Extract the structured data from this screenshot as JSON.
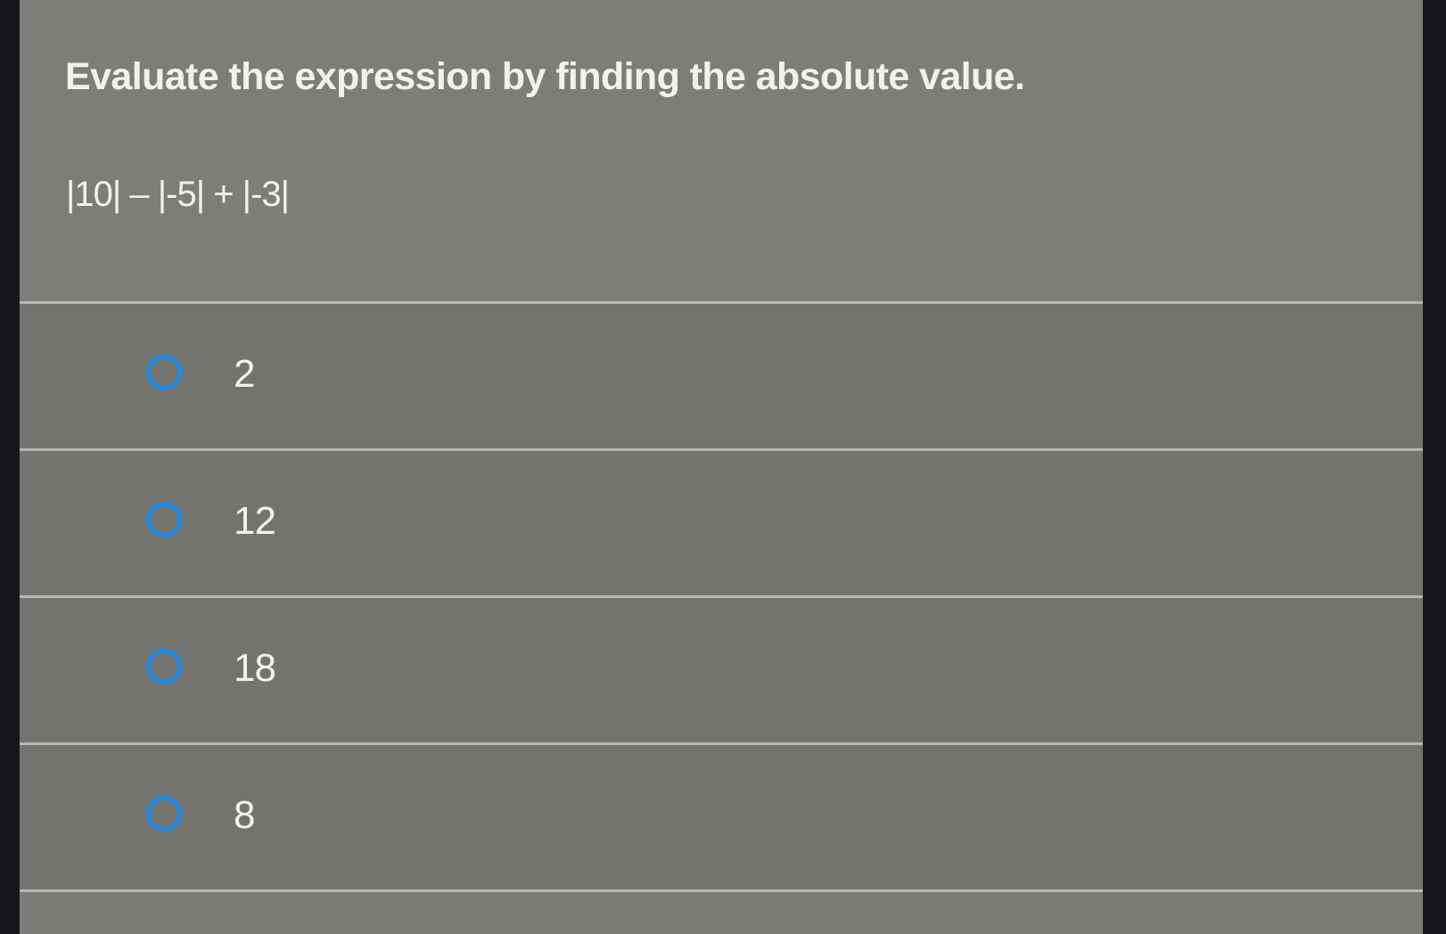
{
  "question": {
    "prompt": "Evaluate the expression by finding the absolute value.",
    "expression": "|10| – |-5| + |-3|"
  },
  "choices": [
    {
      "label": "2"
    },
    {
      "label": "12"
    },
    {
      "label": "18"
    },
    {
      "label": "8"
    }
  ],
  "colors": {
    "radio_ring": "#1e8be8",
    "question_background": "#7d7e7a",
    "choice_background": "#737470",
    "text": "#f1f1ee"
  }
}
